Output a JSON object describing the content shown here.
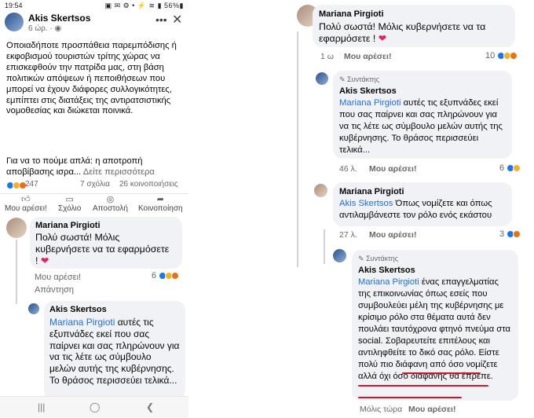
{
  "left": {
    "status": {
      "time": "19:54",
      "right": "▣ ✉ ⚙ •   ⚡ ≋ ▮ 56%▮"
    },
    "post": {
      "author": "Akis Skertsos",
      "time": "6 ώρ. · ",
      "body": "Οποιαδήποτε προσπάθεια παρεμπόδισης ή εκφοβισμού τουριστών τρίτης χώρας να επισκεφθούν την πατρίδα μας, στη βάση πολιτικών απόψεων ή πεποιθήσεων που μπορεί να έχουν διάφορες συλλογικότητες, εμπίπτει στις διατάξεις της αντιρατσιστικής νομοθεσίας και διώκεται ποινικά.",
      "more_text": "Για να το πούμε απλά: η αποτροπή αποβίβασης ισρα...",
      "see_more": " Δείτε περισσότερα",
      "reactions_count": "247",
      "comments": "7 σχόλια",
      "shares": "26 κοινοποιήσεις"
    },
    "actions": {
      "like": "Μου αρέσει!",
      "comment": "Σχόλιο",
      "send": "Αποστολή",
      "share": "Κοινοποίηση"
    },
    "comment1": {
      "name": "Mariana Pirgioti",
      "text": "Πολύ σωστά! Μόλις κυβερνήσετε να τα εφαρμόσετε ! ",
      "like": "Μου αρέσει!",
      "reply": "Απάντηση",
      "count": "6"
    },
    "reply1": {
      "name": "Akis Skertsos",
      "mention": "Mariana Pirgioti",
      "text": " αυτές τις εξυπνάδες εκεί που σας παίρνει και σας πληρώνουν για να τις λέτε ως σύμβουλο μελών αυτής της κυβέρνησης. Το θράσος περισσεύει τελικά..."
    }
  },
  "right": {
    "c1": {
      "name": "Mariana Pirgioti",
      "text": "Πολύ σωστά! Μόλις κυβερνήσετε να τα εφαρμόσετε ! ",
      "time": "1 ω",
      "like": "Μου αρέσει!",
      "count": "10"
    },
    "c2": {
      "badge": "Συντάκτης",
      "name": "Akis Skertsos",
      "mention": "Mariana Pirgioti",
      "text": " αυτές τις εξυπνάδες εκεί που σας παίρνει και σας πληρώνουν για να τις λέτε ως σύμβουλο μελών αυτής της κυβέρνησης. Το θράσος περισσεύει τελικά...",
      "time": "46 λ.",
      "like": "Μου αρέσει!",
      "count": "6"
    },
    "c3": {
      "name": "Mariana Pirgioti",
      "mention": "Akis Skertsos",
      "text": " Όπως νομίζετε και όπως αντιλαμβάνεστε τον ρόλο ενός εκάστου",
      "time": "27 λ.",
      "like": "Μου αρέσει!",
      "count": "3"
    },
    "c4": {
      "badge": "Συντάκτης",
      "name": "Akis Skertsos",
      "mention": "Mariana Pirgioti",
      "text": " ένας επαγγελματίας της επικοινωνίας όπως εσείς που συμβουλεύει μέλη της κυβέρνησης με κρίσιμο ρόλο στα θέματα αυτά δεν πουλάει ταυτόχρονα φτηνό πνεύμα στα social. Σοβαρευτείτε επιτέλους και αντιληφθείτε το δικό σας ρόλο. Είστε πολύ πιο διάφανη από όσο νομίζετε αλλά όχι όσο διαφανής θα έπρεπε.",
      "time": "Μόλις τώρα",
      "like": "Μου αρέσει!"
    }
  },
  "colors": {
    "accent": "#1877f2",
    "mention": "#216fdb",
    "underline": "#d8102a",
    "bubble": "#f0f2f5"
  }
}
